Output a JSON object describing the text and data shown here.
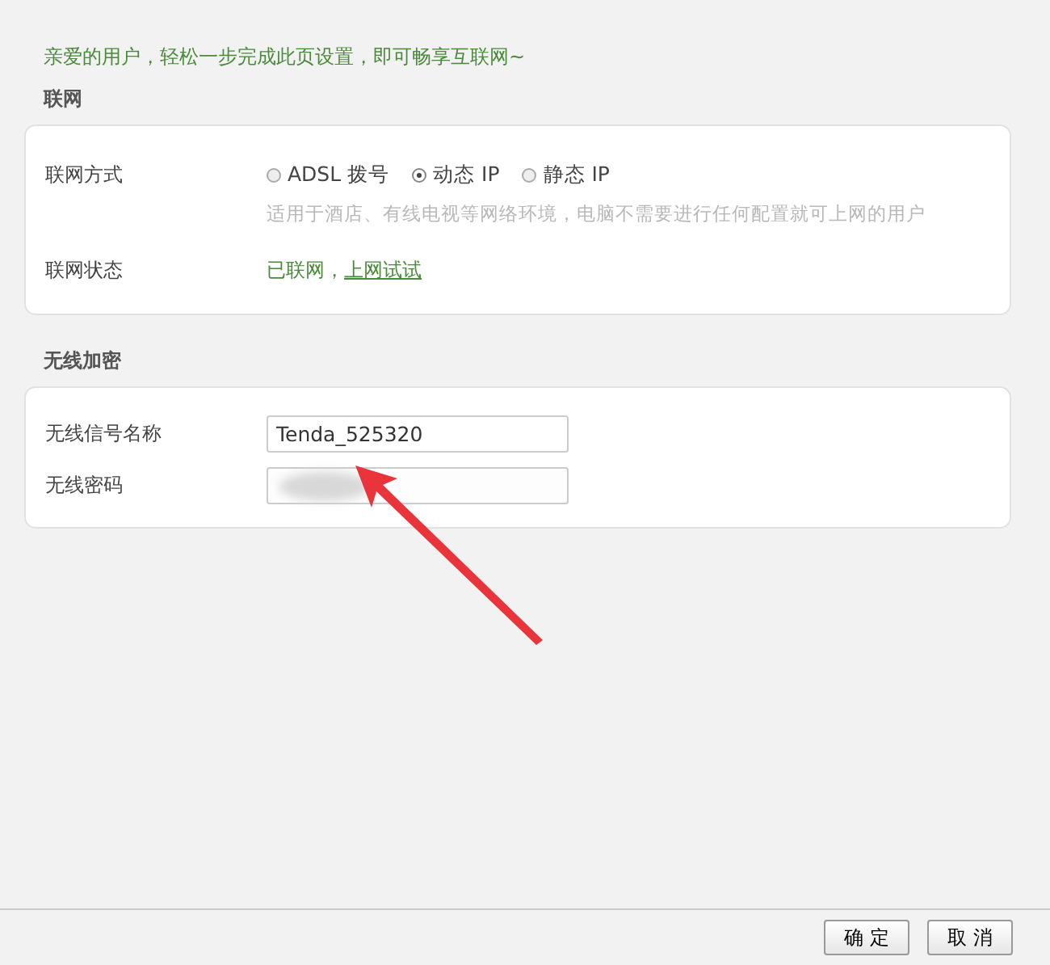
{
  "intro": "亲爱的用户，轻松一步完成此页设置，即可畅享互联网~",
  "internet": {
    "heading": "联网",
    "mode": {
      "label": "联网方式",
      "options": [
        {
          "label": "ADSL 拨号",
          "selected": false
        },
        {
          "label": "动态 IP",
          "selected": true
        },
        {
          "label": "静态 IP",
          "selected": false
        }
      ],
      "hint": "适用于酒店、有线电视等网络环境，电脑不需要进行任何配置就可上网的用户"
    },
    "status": {
      "label": "联网状态",
      "text": "已联网，",
      "link": "上网试试"
    }
  },
  "wireless": {
    "heading": "无线加密",
    "fields": [
      {
        "label": "无线信号名称",
        "value": "Tenda_525320",
        "redacted": false
      },
      {
        "label": "无线密码",
        "redacted": true
      }
    ]
  },
  "buttons": [
    "确 定",
    "取 消"
  ]
}
